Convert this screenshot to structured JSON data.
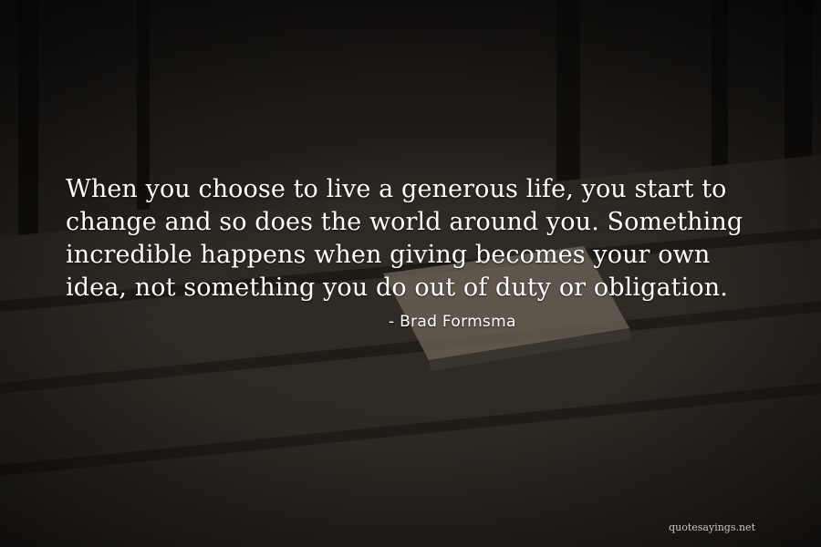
{
  "quote": {
    "text": "When you choose to live a generous life, you start to change and so does the world around you. Something incredible happens when giving becomes your own idea, not something you do out of duty or obligation.",
    "author": "- Brad Formsma"
  },
  "watermark": "quotesayings.net"
}
